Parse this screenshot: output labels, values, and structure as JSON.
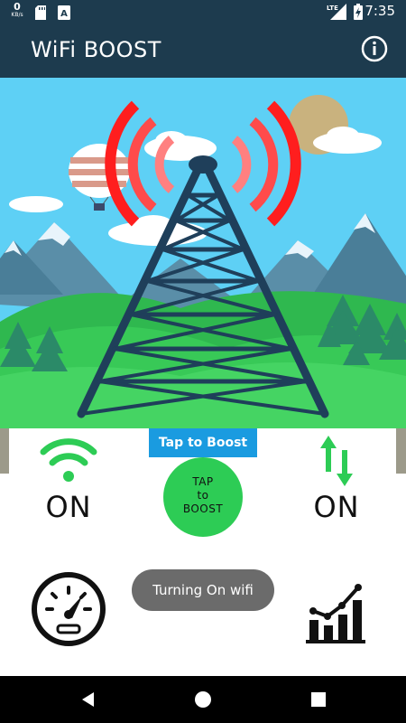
{
  "status_bar": {
    "speed_value": "0",
    "speed_unit": "KB/s",
    "network_label": "LTE",
    "time": "7:35",
    "icons": [
      "sd-card-icon",
      "keyboard-icon",
      "signal-icon",
      "battery-charging-icon"
    ]
  },
  "app_bar": {
    "title": "WiFi BOOST",
    "info_icon": "info-icon"
  },
  "hero": {
    "icons": [
      "tower-icon",
      "signal-waves-icon",
      "hot-air-balloon-icon",
      "sun-icon",
      "cloud-icon",
      "mountain-icon",
      "pine-tree-icon"
    ]
  },
  "colors": {
    "app_bar": "#1d3b4e",
    "sky": "#5ed0f5",
    "grass": "#38c957",
    "tower": "#1f3f5a",
    "signal": "#ff1e1e",
    "boost_button": "#2dcc55",
    "banner": "#1a9be0",
    "toast": "#6b6b6b"
  },
  "features": {
    "wifi": {
      "icon": "wifi-icon",
      "state": "ON"
    },
    "data": {
      "icon": "data-transfer-icon",
      "state": "ON"
    },
    "boost": {
      "banner": "Tap to Boost",
      "line1": "TAP",
      "line2": "to",
      "line3": "BOOST"
    },
    "speed_test": {
      "icon": "speedometer-icon"
    },
    "stats": {
      "icon": "chart-icon"
    }
  },
  "toast": {
    "text": "Turning On wifi"
  },
  "nav_bar": {
    "icons": [
      "back-icon",
      "home-icon",
      "recents-icon"
    ]
  }
}
